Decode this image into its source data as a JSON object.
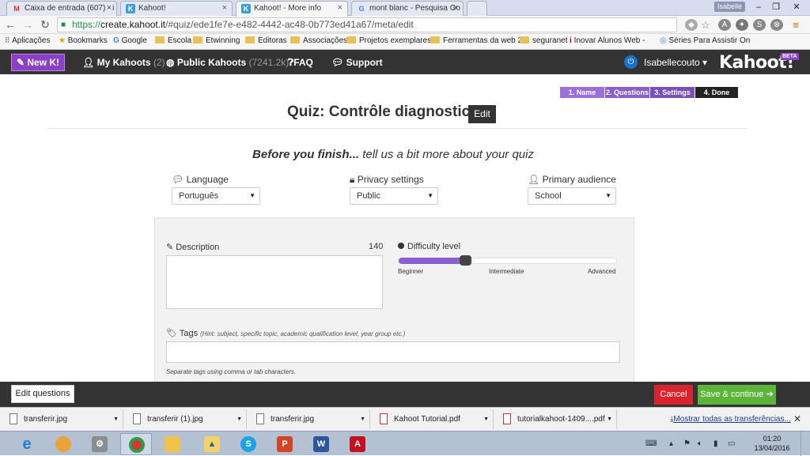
{
  "browser": {
    "tabs": [
      {
        "title": "Caixa de entrada (607) - i",
        "icon": "gmail-icon"
      },
      {
        "title": "Kahoot!",
        "icon": "kahoot-icon"
      },
      {
        "title": "Kahoot! - More info",
        "icon": "kahoot-icon"
      },
      {
        "title": "mont blanc - Pesquisa Go",
        "icon": "google-icon"
      }
    ],
    "user": "Isabelle",
    "url_scheme": "https://",
    "url_host": "create.kahoot.it",
    "url_path": "/#quiz/ede1fe7e-e482-4442-ac48-0b773ed41a67/meta/edit",
    "bookmarks": [
      "Aplicações",
      "Bookmarks",
      "Google",
      "Escola",
      "Etwinning",
      "Editoras",
      "Associações",
      "Projetos exemplares",
      "Ferramentas da web 2",
      "seguranet",
      "Inovar Alunos Web - ",
      "Séries Para Assistir On"
    ]
  },
  "header": {
    "new_k": "New K!",
    "my_kahoots": "My Kahoots",
    "my_kahoots_count": "(2)",
    "public_kahoots": "Public Kahoots",
    "public_kahoots_count": "(7241.2k)",
    "faq": "FAQ",
    "support": "Support",
    "username": "Isabellecouto",
    "logo": "Kahoot!",
    "beta": "BETA"
  },
  "steps": [
    "1. Name",
    "2. Questions",
    "3. Settings",
    "4. Done"
  ],
  "quiz": {
    "title": "Quiz: Contrôle diagnostic",
    "edit": "Edit",
    "subtitle_bold": "Before you finish...",
    "subtitle_rest": " tell us a bit more about your quiz"
  },
  "fields": {
    "language_label": "Language",
    "language_value": "Português",
    "privacy_label": "Privacy settings",
    "privacy_value": "Public",
    "audience_label": "Primary audience",
    "audience_value": "School",
    "description_label": "Description",
    "description_count": "140",
    "difficulty_label": "Difficulty level",
    "difficulty_fraction": 0.31,
    "difficulty_levels": [
      "Beginner",
      "Intermediate",
      "Advanced"
    ],
    "tags_label": "Tags",
    "tags_hint": "(Hint: subject, specific topic, academic qualification level, year group etc.)",
    "tags_help": "Separate tags using comma or tab characters."
  },
  "actions": {
    "edit_questions": "Edit questions",
    "cancel": "Cancel",
    "save_continue": "Save & continue"
  },
  "downloads": {
    "items": [
      "transferir.jpg",
      "transferir (1).jpg",
      "transferir.jpg",
      "Kahoot Tutorial.pdf",
      "tutorialkahoot-1409....pdf"
    ],
    "show_all": "Mostrar todas as transferências..."
  },
  "taskbar": {
    "time": "01:20",
    "date": "13/04/2016"
  },
  "colors": {
    "kahoot_purple": "#8b3fc6",
    "header_dark": "#333333",
    "cancel_red": "#d9232e",
    "save_green": "#5cb53a"
  }
}
